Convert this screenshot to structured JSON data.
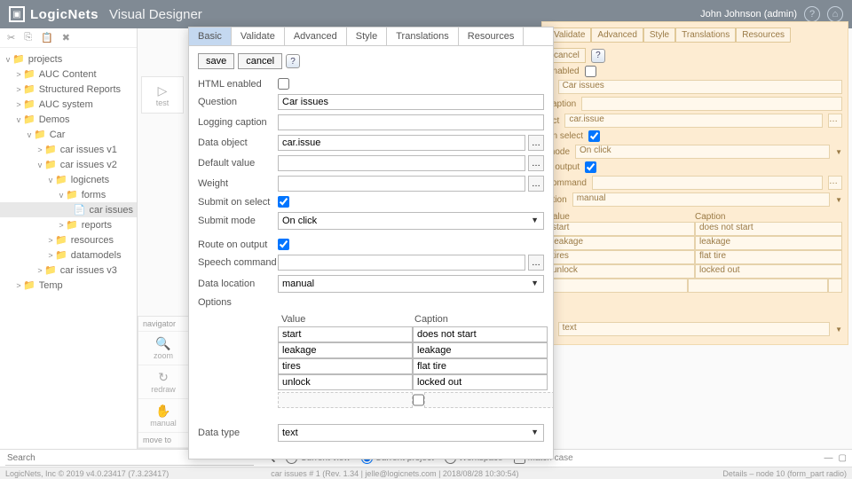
{
  "header": {
    "brand": "LogicNets",
    "subtitle": "Visual Designer",
    "user": "John Johnson (admin)"
  },
  "tree": {
    "root": "projects",
    "items": [
      {
        "label": "AUC Content",
        "indent": 1,
        "caret": ">",
        "type": "folder"
      },
      {
        "label": "Structured Reports",
        "indent": 1,
        "caret": ">",
        "type": "folder"
      },
      {
        "label": "AUC system",
        "indent": 1,
        "caret": ">",
        "type": "folder"
      },
      {
        "label": "Demos",
        "indent": 1,
        "caret": "v",
        "type": "folder"
      },
      {
        "label": "Car",
        "indent": 2,
        "caret": "v",
        "type": "folder"
      },
      {
        "label": "car issues v1",
        "indent": 3,
        "caret": ">",
        "type": "folder"
      },
      {
        "label": "car issues v2",
        "indent": 3,
        "caret": "v",
        "type": "folder"
      },
      {
        "label": "logicnets",
        "indent": 4,
        "caret": "v",
        "type": "folder"
      },
      {
        "label": "forms",
        "indent": 5,
        "caret": "v",
        "type": "folder"
      },
      {
        "label": "car issues",
        "indent": 6,
        "caret": "",
        "type": "file",
        "selected": true
      },
      {
        "label": "reports",
        "indent": 5,
        "caret": ">",
        "type": "folder"
      },
      {
        "label": "resources",
        "indent": 4,
        "caret": ">",
        "type": "folder"
      },
      {
        "label": "datamodels",
        "indent": 4,
        "caret": ">",
        "type": "folder"
      },
      {
        "label": "car issues v3",
        "indent": 3,
        "caret": ">",
        "type": "folder"
      },
      {
        "label": "Temp",
        "indent": 1,
        "caret": ">",
        "type": "folder"
      }
    ]
  },
  "canvas": {
    "details": "Details",
    "test": "test",
    "navigator": "navigator",
    "zoom": "zoom",
    "redraw": "redraw",
    "manual": "manual",
    "moveto": "move to"
  },
  "bg": {
    "tabs": [
      "Validate",
      "Advanced",
      "Style",
      "Translations",
      "Resources"
    ],
    "cancel": "cancel",
    "labels": {
      "enabled": "enabled",
      "n": "n",
      "caption": "caption",
      "ect": "ect",
      "select": "on select",
      "mode": "mode",
      "output": "n output",
      "command": "command",
      "ation": "ation"
    },
    "question": "Car issues",
    "dataobj": "car.issue",
    "submitmode": "On click",
    "dataloc": "manual",
    "tbl_hdr": {
      "value": "Value",
      "caption": "Caption"
    },
    "rows": [
      [
        "start",
        "does not start"
      ],
      [
        "leakage",
        "leakage"
      ],
      [
        "tires",
        "flat tire"
      ],
      [
        "unlock",
        "locked out"
      ]
    ],
    "e": "e",
    "datatype": "text"
  },
  "modal": {
    "tabs": [
      "Basic",
      "Validate",
      "Advanced",
      "Style",
      "Translations",
      "Resources"
    ],
    "save": "save",
    "cancel": "cancel",
    "labels": {
      "html": "HTML enabled",
      "question": "Question",
      "logging": "Logging caption",
      "dataobj": "Data object",
      "default": "Default value",
      "weight": "Weight",
      "submit_select": "Submit on select",
      "submit_mode": "Submit mode",
      "route": "Route on output",
      "speech": "Speech command",
      "dataloc": "Data location",
      "options": "Options",
      "datatype": "Data type"
    },
    "values": {
      "question": "Car issues",
      "logging": "",
      "dataobj": "car.issue",
      "default": "",
      "weight": "",
      "submit_mode": "On click",
      "speech": "",
      "dataloc": "manual",
      "datatype": "text"
    },
    "options_hdr": {
      "value": "Value",
      "caption": "Caption"
    },
    "options": [
      [
        "start",
        "does not start"
      ],
      [
        "leakage",
        "leakage"
      ],
      [
        "tires",
        "flat tire"
      ],
      [
        "unlock",
        "locked out"
      ]
    ]
  },
  "footer": {
    "search": "Search",
    "current_view": "Current view",
    "current_project": "Current project",
    "workspace": "Workspace",
    "match": "Match case"
  },
  "status": {
    "left": "LogicNets, Inc © 2019 v4.0.23417 (7.3.23417)",
    "center": "car issues # 1 (Rev. 1.34 | jelle@logicnets.com | 2018/08/28 10:30:54)",
    "right": "Details – node 10 (form_part radio)"
  }
}
